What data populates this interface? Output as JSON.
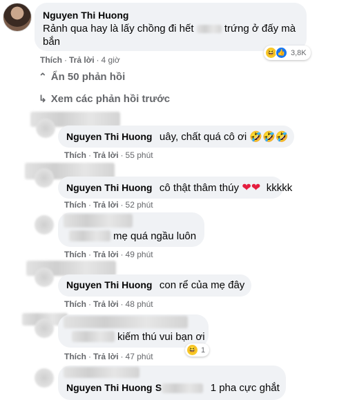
{
  "main_comment": {
    "name": "Nguyen Thi Huong",
    "text_line1_a": "Rảnh qua hay là lấy chồng đi hết",
    "text_line1_b": "trứng ở đấy mà",
    "text_line2": "bắn",
    "like": "Thích",
    "reply": "Trả lời",
    "time": "4 giờ",
    "reaction_count": "3,8K"
  },
  "hide_replies": "Ẩn 50 phản hồi",
  "prev_replies": "Xem các phản hồi trước",
  "replies": [
    {
      "name": "Nguyen Thi Huong",
      "text": "uây, chất quá cô ơi 🤣🤣🤣",
      "time": "55 phút"
    },
    {
      "name": "Nguyen Thi Huong",
      "text": "cô thật thâm thúy",
      "hearts": "❤❤",
      "text2": "kkkkk",
      "time": "52 phút"
    },
    {
      "name": "",
      "text": "mẹ quá ngầu luôn",
      "time": "49 phút"
    },
    {
      "name": "Nguyen Thi Huong",
      "text": "con rể của mẹ đây",
      "time": "48 phút"
    },
    {
      "name": "",
      "text": "kiếm thú vui bạn ơi",
      "time": "47 phút",
      "reaction_count": "1"
    },
    {
      "name": "Nguyen Thi Huong",
      "name_suffix": "S",
      "text": "1 pha cực ghắt"
    }
  ],
  "labels": {
    "like": "Thích",
    "reply": "Trả lời"
  }
}
